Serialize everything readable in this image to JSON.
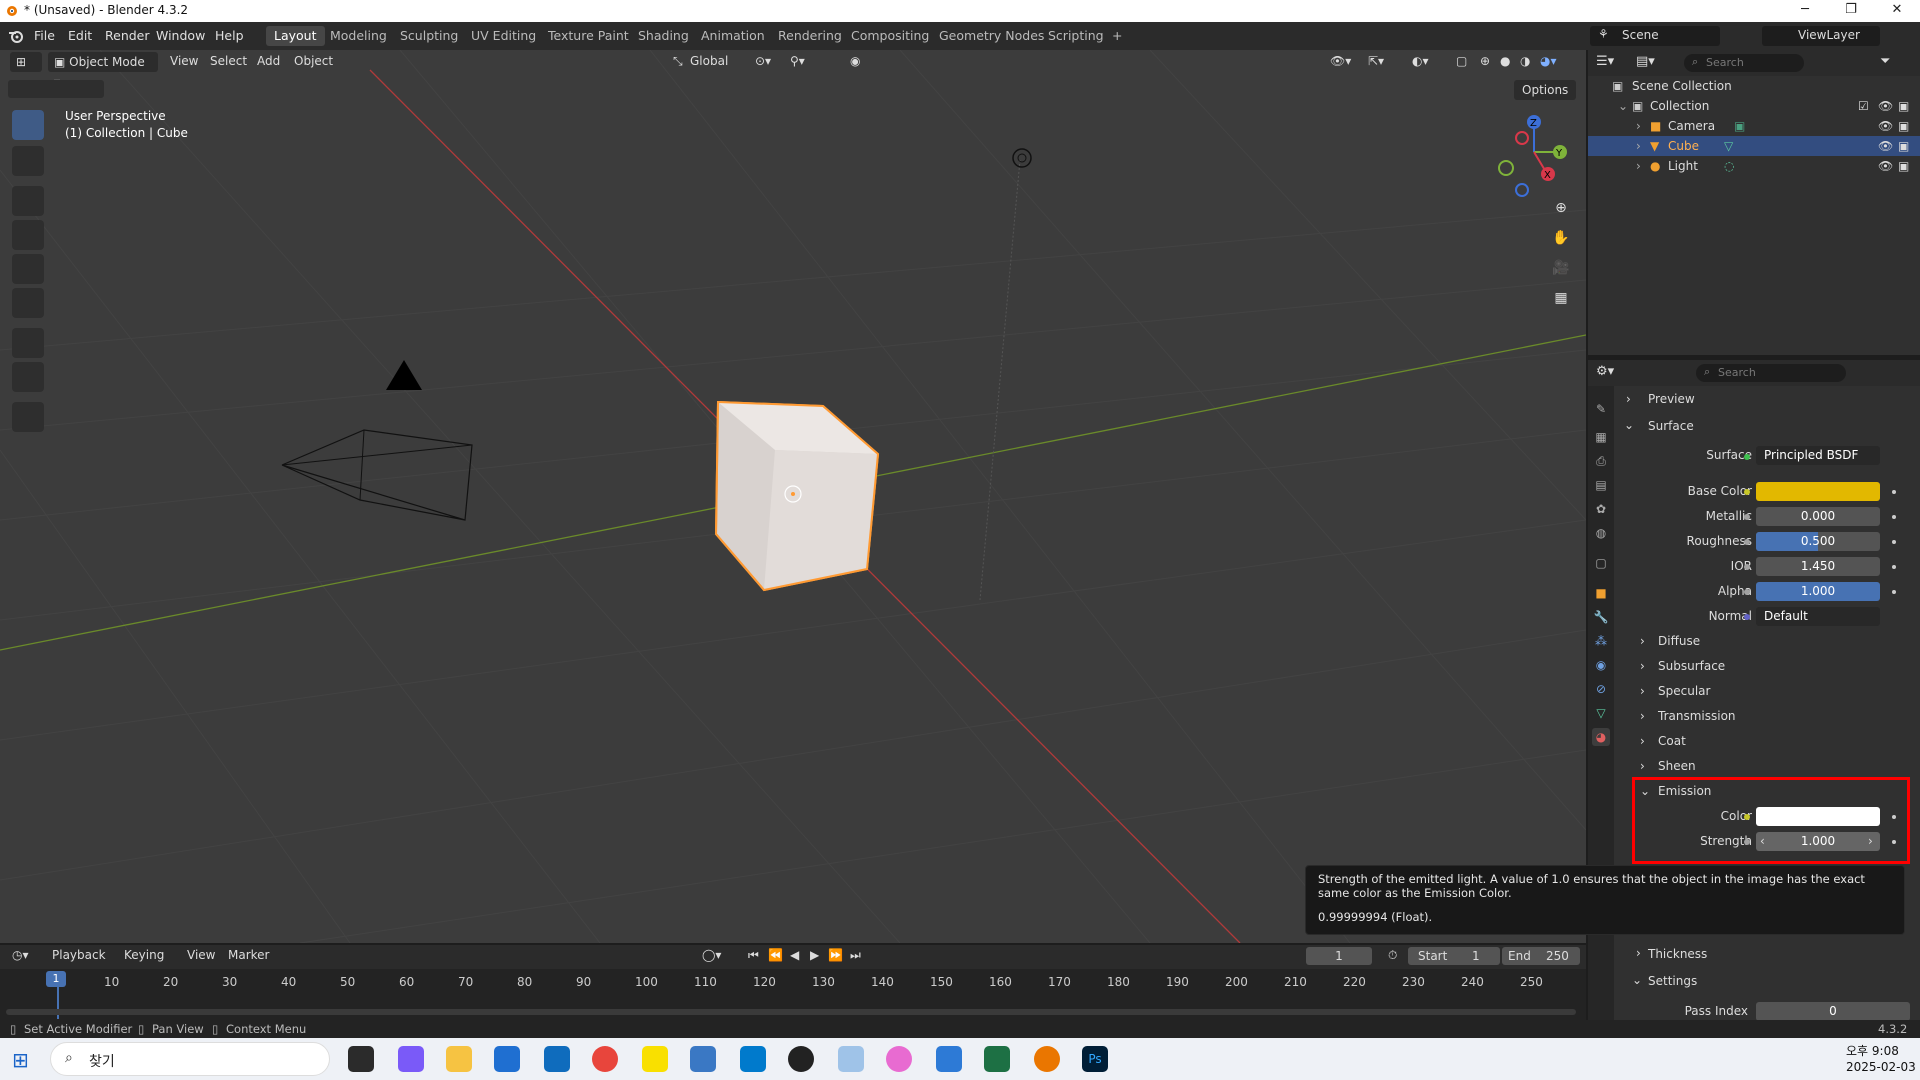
{
  "window": {
    "title": "* (Unsaved) - Blender 4.3.2",
    "minimize": "─",
    "maximize": "❐",
    "close": "✕"
  },
  "menus": [
    "File",
    "Edit",
    "Render",
    "Window",
    "Help"
  ],
  "workspaces": [
    "Layout",
    "Modeling",
    "Sculpting",
    "UV Editing",
    "Texture Paint",
    "Shading",
    "Animation",
    "Rendering",
    "Compositing",
    "Geometry Nodes",
    "Scripting"
  ],
  "workspace_add": "+",
  "scene": {
    "name": "Scene",
    "view_layer": "ViewLayer"
  },
  "viewport": {
    "mode": "Object Mode",
    "menus": [
      "View",
      "Select",
      "Add",
      "Object"
    ],
    "transform_orientation": "Global",
    "options": "Options",
    "overlay_line1": "User Perspective",
    "overlay_line2": "(1) Collection | Cube",
    "gizmo": {
      "x": "X",
      "y": "Y",
      "z": "Z"
    }
  },
  "outliner": {
    "search_placeholder": "Search",
    "items": [
      {
        "label": "Scene Collection"
      },
      {
        "label": "Collection"
      },
      {
        "label": "Camera"
      },
      {
        "label": "Cube"
      },
      {
        "label": "Light"
      }
    ]
  },
  "properties": {
    "search_placeholder": "Search",
    "sections": {
      "preview": "Preview",
      "surface": "Surface",
      "diffuse": "Diffuse",
      "subsurface": "Subsurface",
      "specular": "Specular",
      "transmission": "Transmission",
      "coat": "Coat",
      "sheen": "Sheen",
      "emission": "Emission",
      "thickness": "Thickness",
      "settings": "Settings"
    },
    "surface": {
      "label": "Surface",
      "value": "Principled BSDF"
    },
    "fields": [
      {
        "label": "Base Color",
        "value": "",
        "color": "#e2b800"
      },
      {
        "label": "Metallic",
        "value": "0.000",
        "fill": 0.0
      },
      {
        "label": "Roughness",
        "value": "0.500",
        "fill": 0.5
      },
      {
        "label": "IOR",
        "value": "1.450",
        "fill": 0.0
      },
      {
        "label": "Alpha",
        "value": "1.000",
        "fill": 1.0
      },
      {
        "label": "Normal",
        "value": "Default"
      }
    ],
    "emission": {
      "color_label": "Color",
      "strength_label": "Strength",
      "strength_value": "1.000",
      "color": "#ffffff"
    },
    "settings": {
      "pass_index_label": "Pass Index",
      "pass_index_value": "0"
    }
  },
  "tooltip": {
    "line1": "Strength of the emitted light. A value of 1.0 ensures that the object in the image has the exact same color as the Emission Color.",
    "line2": "0.99999994 (Float)."
  },
  "timeline": {
    "menus": [
      "Playback",
      "Keying",
      "View",
      "Marker"
    ],
    "current_frame": "1",
    "start_label": "Start",
    "start": "1",
    "end_label": "End",
    "end": "250",
    "ticks": [
      "10",
      "20",
      "30",
      "40",
      "50",
      "60",
      "70",
      "80",
      "90",
      "100",
      "110",
      "120",
      "130",
      "140",
      "150",
      "160",
      "170",
      "180",
      "190",
      "200",
      "210",
      "220",
      "230",
      "240",
      "250"
    ]
  },
  "status": {
    "items": [
      "Set Active Modifier",
      "Pan View",
      "Context Menu"
    ],
    "version": "4.3.2"
  },
  "taskbar": {
    "search": "찾기",
    "time": "오후 9:08",
    "date": "2025-02-03"
  },
  "colors": {
    "accent": "#4772b3",
    "selection": "#334d80",
    "highlight_box": "#ff0000",
    "active_object": "#ff9a33"
  }
}
